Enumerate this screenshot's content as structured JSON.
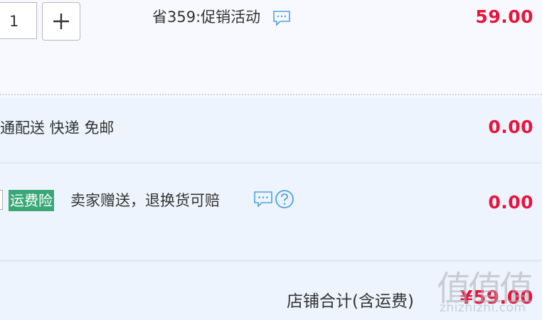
{
  "item": {
    "quantity": "1",
    "plus_symbol": "+",
    "promo_text": "省359:促销活动",
    "price": "59.00"
  },
  "shipping": {
    "text": "通配送 快递 免邮",
    "price": "0.00"
  },
  "insurance": {
    "badge": "运费险",
    "text": "卖家赠送，退换货可赔",
    "price": "0.00"
  },
  "total": {
    "label": "店铺合计(含运费)",
    "amount": "¥59.00"
  },
  "watermark": {
    "big": "值值值",
    "small": "zhizhizhi.com"
  },
  "colors": {
    "price_red": "#e8143c",
    "badge_green": "#3aa876",
    "icon_blue": "#4aa3df",
    "row_bg": "#eef4fd"
  },
  "icons": [
    "chat-icon",
    "chat-icon",
    "help-icon"
  ]
}
